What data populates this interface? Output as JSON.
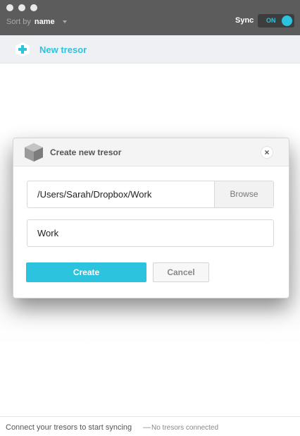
{
  "titlebar": {
    "sort_label": "Sort by",
    "sort_value": "name",
    "sync_label": "Sync",
    "sync_toggle": "ON"
  },
  "new_tresor": {
    "label": "New tresor"
  },
  "dialog": {
    "title": "Create new tresor",
    "close": "×",
    "path_value": "/Users/Sarah/Dropbox/Work",
    "browse_label": "Browse",
    "name_value": "Work",
    "create_label": "Create",
    "cancel_label": "Cancel"
  },
  "footer": {
    "message": "Connect your tresors to start syncing",
    "separator": "—",
    "status": "No tresors connected"
  },
  "colors": {
    "accent": "#2cc3de",
    "titlebar": "#5c5c5c"
  },
  "icons": {
    "new_tresor": "plus-icon",
    "dialog": "cube-icon",
    "close": "close-icon",
    "sort": "chevron-down-icon"
  }
}
